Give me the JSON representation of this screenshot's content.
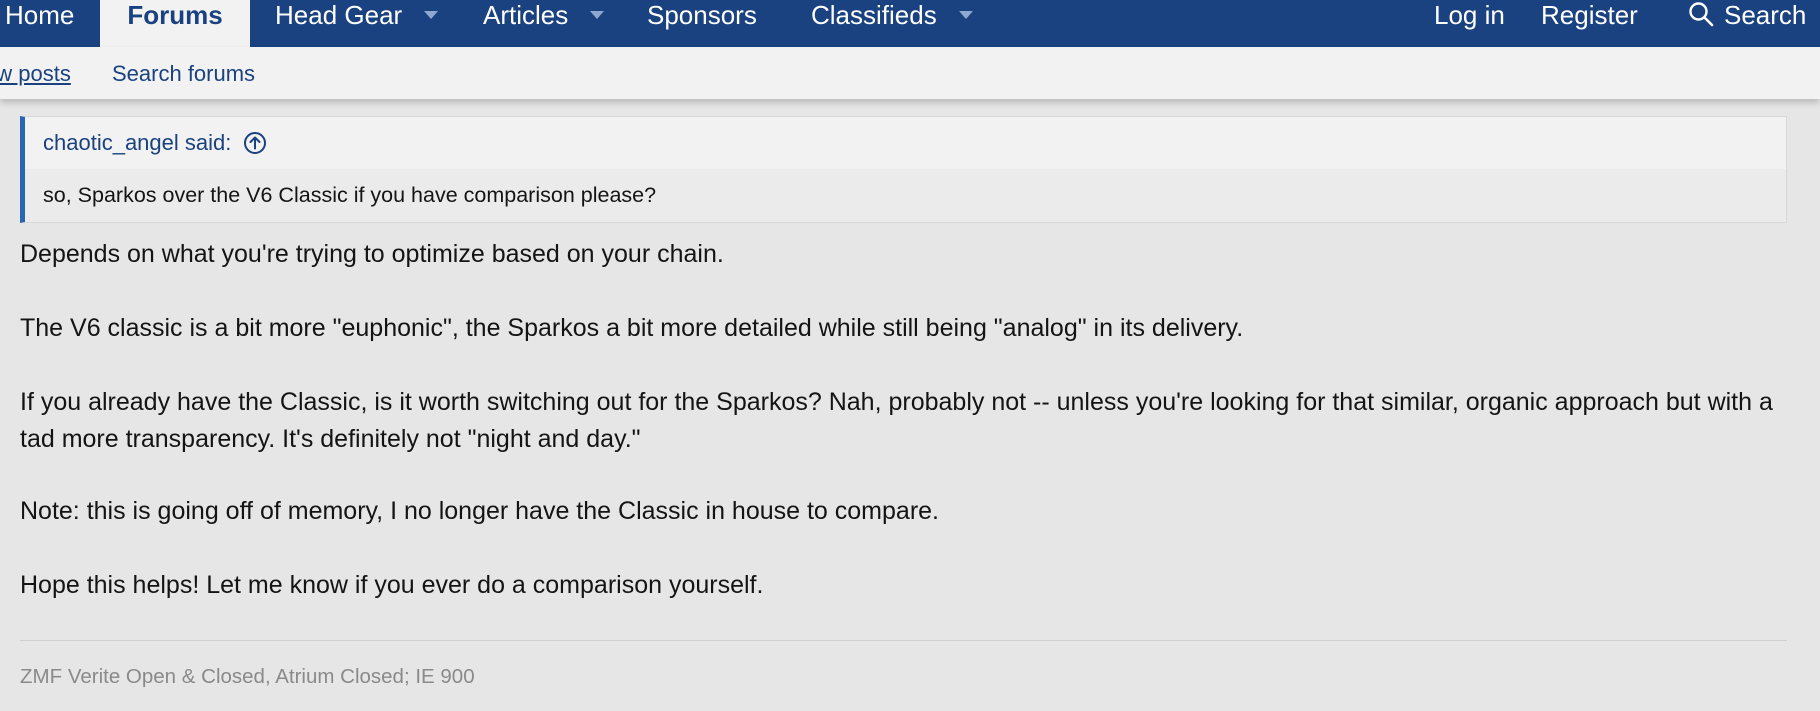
{
  "nav": {
    "home": "Home",
    "forums": "Forums",
    "head_gear": "Head Gear",
    "articles": "Articles",
    "sponsors": "Sponsors",
    "classifieds": "Classifieds",
    "login": "Log in",
    "register": "Register",
    "search": "Search"
  },
  "subnav": {
    "new_posts": "ew posts",
    "search_forums": "Search forums"
  },
  "post": {
    "quote": {
      "author": "chaotic_angel said:",
      "text": "so, Sparkos over the V6 Classic if you have comparison please?"
    },
    "paragraphs": [
      "Depends on what you're trying to optimize based on your chain.",
      "The V6 classic is a bit more \"euphonic\", the Sparkos a bit more detailed while still being \"analog\" in its delivery.",
      "If you already have the Classic, is it worth switching out for the Sparkos? Nah, probably not -- unless you're looking for that similar, organic approach but with a tad more transparency. It's definitely not \"night and day.\"",
      "Note: this is going off of memory, I no longer have the Classic in house to compare.",
      "Hope this helps! Let me know if you ever do a comparison yourself."
    ],
    "signature": "ZMF Verite Open & Closed, Atrium Closed; IE 900"
  },
  "colors": {
    "nav_bg": "#1a4180",
    "accent": "#2c64b4",
    "link": "#1a4180",
    "page_bg": "#e6e6e6"
  },
  "icons": {
    "dropdown": "chevron-down-icon",
    "search": "search-icon",
    "jump_to_quote": "arrow-up-circle-icon"
  }
}
